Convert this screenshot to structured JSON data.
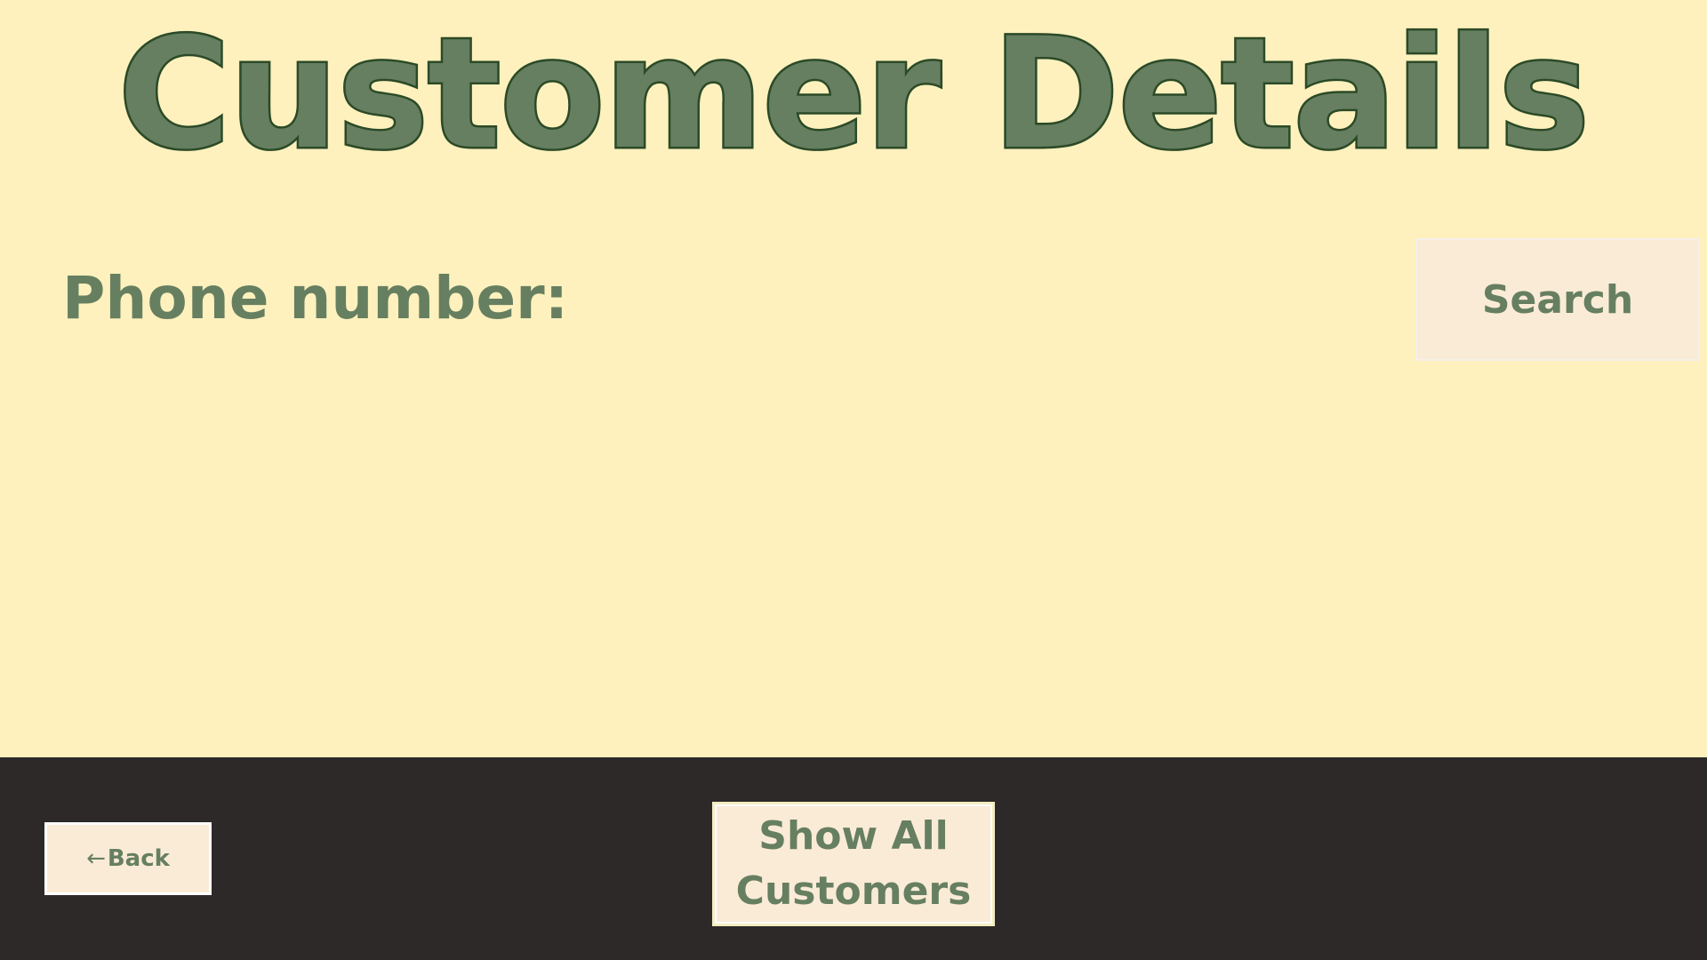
{
  "header": {
    "title": "Customer Details"
  },
  "search": {
    "label": "Phone number:",
    "value": "",
    "button_label": "Search"
  },
  "footer": {
    "back_arrow": "←",
    "back_label": "Back",
    "show_all_label": "Show All Customers"
  },
  "colors": {
    "background": "#fff1bd",
    "text_green": "#667f60",
    "title_outline": "#2b4a27",
    "button_fill": "#faebd7",
    "footer_bar": "#2d2929"
  }
}
